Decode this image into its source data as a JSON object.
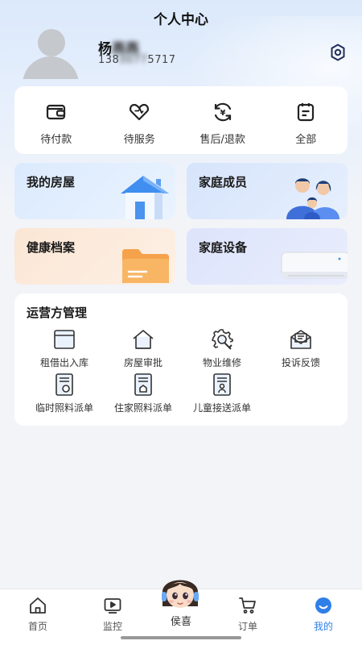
{
  "header": {
    "title": "个人中心"
  },
  "user": {
    "name_visible": "杨",
    "name_blurred": "燕燕",
    "phone_prefix": "138",
    "phone_blurred": "0077",
    "phone_suffix": "5717"
  },
  "orders": [
    {
      "label": "待付款",
      "icon": "wallet-icon"
    },
    {
      "label": "待服务",
      "icon": "heart-icon"
    },
    {
      "label": "售后/退款",
      "icon": "refund-icon"
    },
    {
      "label": "全部",
      "icon": "clipboard-icon"
    }
  ],
  "tiles": [
    {
      "label": "我的房屋",
      "icon": "house-illustration"
    },
    {
      "label": "家庭成员",
      "icon": "family-illustration"
    },
    {
      "label": "健康档案",
      "icon": "folder-illustration"
    },
    {
      "label": "家庭设备",
      "icon": "air-conditioner-illustration"
    }
  ],
  "operations": {
    "title": "运营方管理",
    "items": [
      {
        "label": "租借出入库",
        "icon": "window-icon"
      },
      {
        "label": "房屋审批",
        "icon": "house-outline-icon"
      },
      {
        "label": "物业维修",
        "icon": "gear-wrench-icon"
      },
      {
        "label": "投诉反馈",
        "icon": "mail-icon"
      },
      {
        "label": "临时照料派单",
        "icon": "document-icon"
      },
      {
        "label": "住家照料派单",
        "icon": "document-home-icon"
      },
      {
        "label": "儿童接送派单",
        "icon": "document-child-icon"
      }
    ]
  },
  "tabbar": {
    "items": [
      {
        "label": "首页",
        "icon": "home-icon"
      },
      {
        "label": "监控",
        "icon": "video-icon"
      },
      {
        "label": "侯喜",
        "icon": "assistant-avatar"
      },
      {
        "label": "订单",
        "icon": "cart-icon"
      },
      {
        "label": "我的",
        "icon": "profile-icon"
      }
    ],
    "active": "我的"
  },
  "colors": {
    "accent": "#2f7fe8",
    "icon_dark": "#222222"
  }
}
